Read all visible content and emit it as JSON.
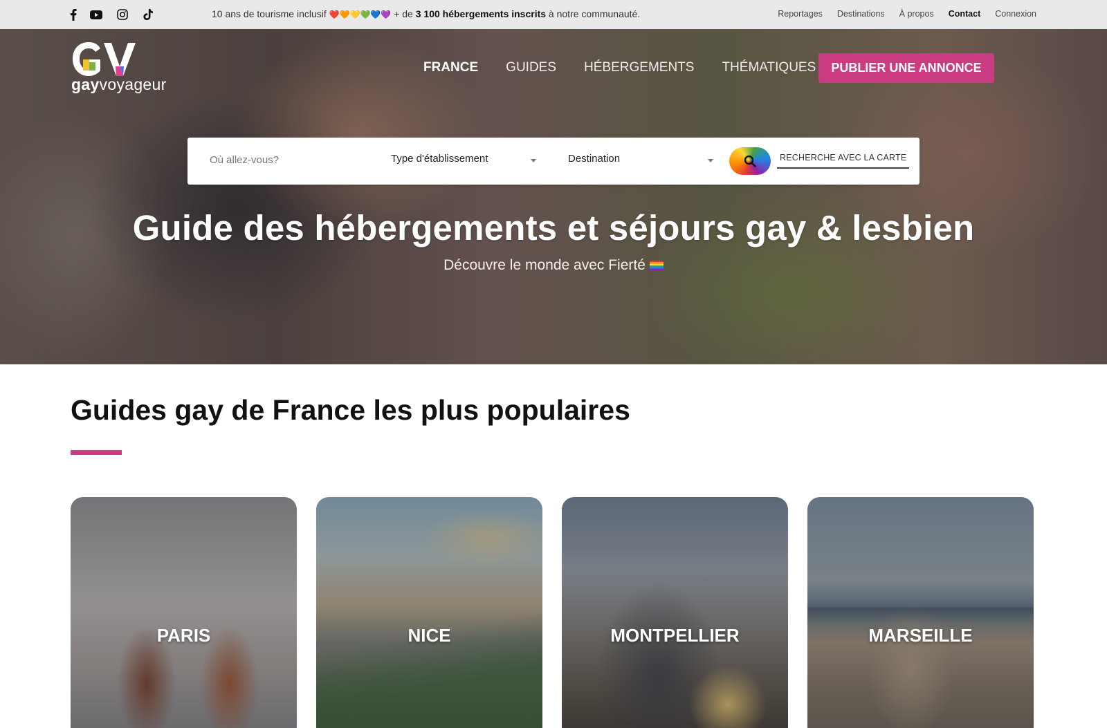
{
  "topbar": {
    "social": [
      {
        "name": "facebook-icon"
      },
      {
        "name": "youtube-icon"
      },
      {
        "name": "instagram-icon"
      },
      {
        "name": "tiktok-icon"
      }
    ],
    "announcement": {
      "prefix": "10 ans de tourisme inclusif",
      "hearts": "❤️🧡💛💚💙💜",
      "middle": " + de ",
      "highlight": "3 100 hébergements inscrits",
      "suffix": " à notre communauté."
    },
    "links": [
      "Reportages",
      "Destinations",
      "À propos",
      "Contact",
      "Connexion"
    ]
  },
  "header": {
    "logo_mark": "GV",
    "logo_text_bold": "gay",
    "logo_text_rest": "voyageur",
    "nav": [
      "FRANCE",
      "GUIDES",
      "HÉBERGEMENTS",
      "THÉMATIQUES"
    ],
    "cta": "PUBLIER UNE ANNONCE"
  },
  "search": {
    "where_placeholder": "Où allez-vous?",
    "type_value": "Type d'établissement",
    "destination_value": "Destination",
    "map_label": "RECHERCHE AVEC LA CARTE"
  },
  "hero": {
    "title": "Guide des hébergements et séjours gay & lesbien",
    "subtitle": "Découvre le monde avec Fierté"
  },
  "popular": {
    "title": "Guides gay de France les plus populaires",
    "cities": [
      "PARIS",
      "NICE",
      "MONTPELLIER",
      "MARSEILLE"
    ]
  },
  "colors": {
    "accent": "#cb3b82",
    "topbar_bg": "#e9e9e9"
  }
}
